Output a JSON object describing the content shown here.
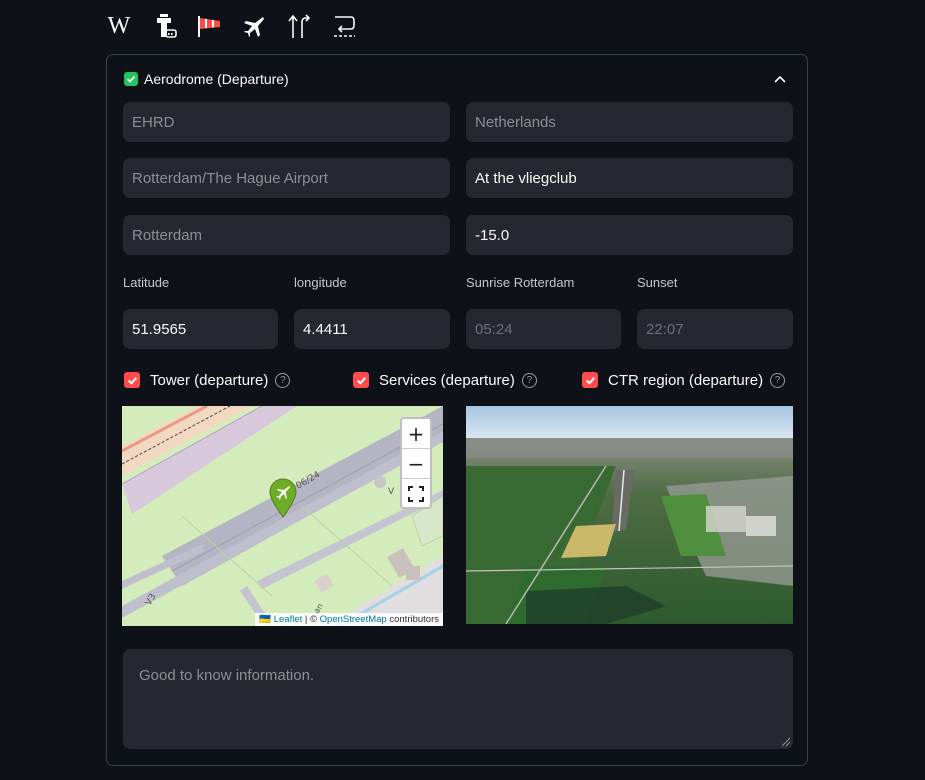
{
  "toolbar": {
    "wiki_glyph": "W",
    "icons": [
      "wikipedia-icon",
      "control-tower-icon",
      "windsock-icon",
      "airplane-icon",
      "route-arrows-icon",
      "runway-return-icon"
    ]
  },
  "section": {
    "title": "Aerodrome (Departure)",
    "checked": true,
    "collapse_icon": "chevron-up-icon"
  },
  "fields": {
    "icao": {
      "placeholder": "EHRD",
      "value": ""
    },
    "country": {
      "placeholder": "Netherlands",
      "value": ""
    },
    "airport_name": {
      "placeholder": "Rotterdam/The Hague Airport",
      "value": ""
    },
    "location_note": {
      "placeholder": "",
      "value": "At the vliegclub"
    },
    "city": {
      "placeholder": "Rotterdam",
      "value": ""
    },
    "elevation": {
      "placeholder": "",
      "value": "-15.0"
    }
  },
  "coords": {
    "latitude_label": "Latitude",
    "latitude_value": "51.9565",
    "longitude_label": "longitude",
    "longitude_value": "4.4411",
    "sunrise_label": "Sunrise Rotterdam",
    "sunrise_value": "05:24",
    "sunset_label": "Sunset",
    "sunset_value": "22:07"
  },
  "options": [
    {
      "label": "Tower (departure)",
      "checked": true
    },
    {
      "label": "Services (departure)",
      "checked": true
    },
    {
      "label": "CTR region (departure)",
      "checked": true
    }
  ],
  "map": {
    "zoom_in": "+",
    "zoom_out": "−",
    "runway_labels": [
      "06/24",
      "V",
      "V3",
      "an"
    ],
    "attrib_prefix": "🇺🇦",
    "attrib_leaflet": "Leaflet",
    "attrib_sep": " | © ",
    "attrib_osm": "OpenStreetMap",
    "attrib_suffix": " contributors"
  },
  "notes": {
    "placeholder": "Good to know information.",
    "value": ""
  },
  "colors": {
    "background": "#0e1117",
    "field": "#262730",
    "accent_red": "#ff4b4b",
    "accent_green": "#21c45d",
    "border": "#3b3f48"
  }
}
